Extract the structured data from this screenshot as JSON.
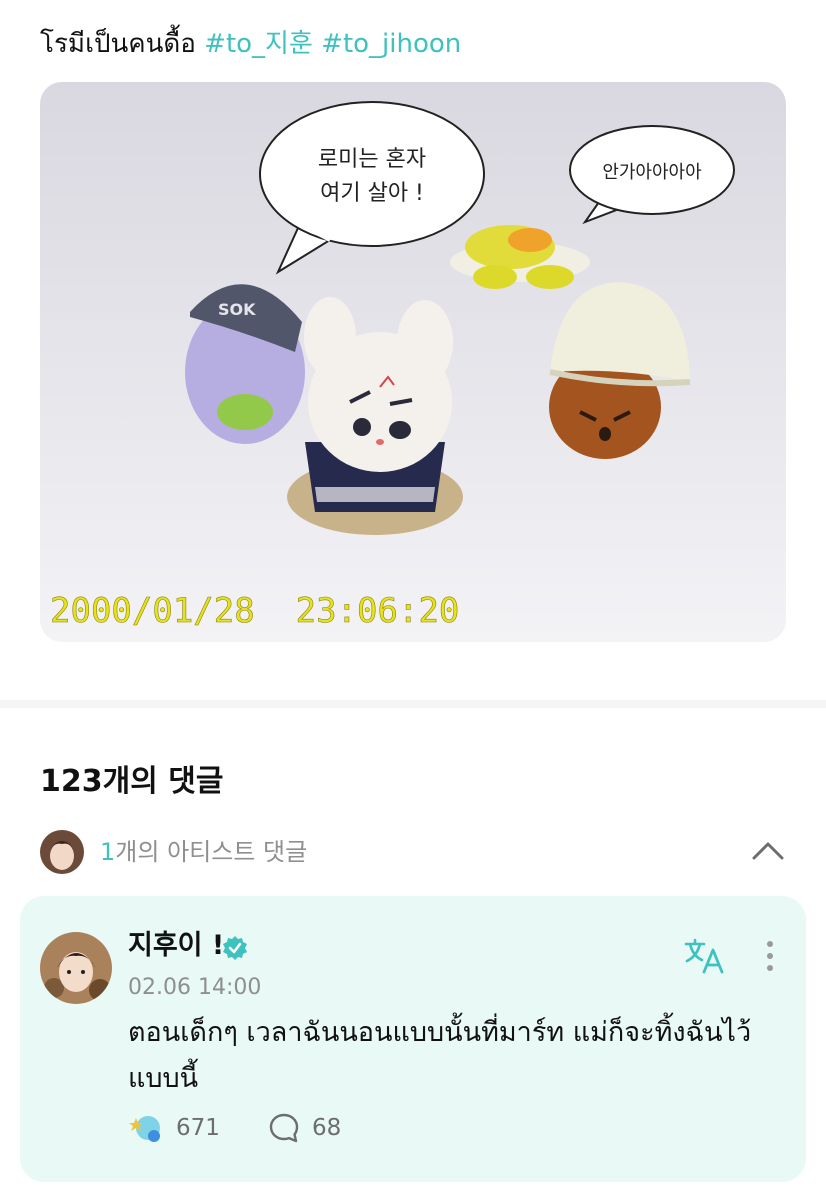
{
  "post": {
    "caption": "โรมีเป็นคนดื้อ",
    "hashtags": [
      "#to_지훈",
      "#to_jihoon"
    ],
    "photo": {
      "speech_bubble_1_line1": "로미는 혼자",
      "speech_bubble_1_line2": "여기 살아 !",
      "speech_bubble_2": "안가아아아아",
      "timestamp_overlay": "2000/01/28  23:06:20",
      "hat_text": "SOK"
    }
  },
  "comments": {
    "count_label": "123개의 댓글",
    "artist_comments": {
      "count": "1",
      "label": "개의 아티스트 댓글"
    },
    "items": [
      {
        "author": "지후이 !",
        "date": "02.06 14:00",
        "text": "ตอนเด็กๆ เวลาฉันนอนแบบนั้นที่มาร์ท แม่ก็จะทิ้งฉันไว้แบบนี้",
        "likes": "671",
        "replies": "68"
      }
    ]
  },
  "icons": {
    "collapse": "chevron-up-icon",
    "verified": "verified-badge-icon",
    "translate": "translate-icon",
    "more": "more-vertical-icon",
    "like": "like-reaction-icon",
    "reply": "speech-bubble-icon"
  },
  "colors": {
    "accent": "#3fc1bf",
    "card_bg": "#e8f9f6",
    "timestamp_yellow": "#e8e21a"
  }
}
